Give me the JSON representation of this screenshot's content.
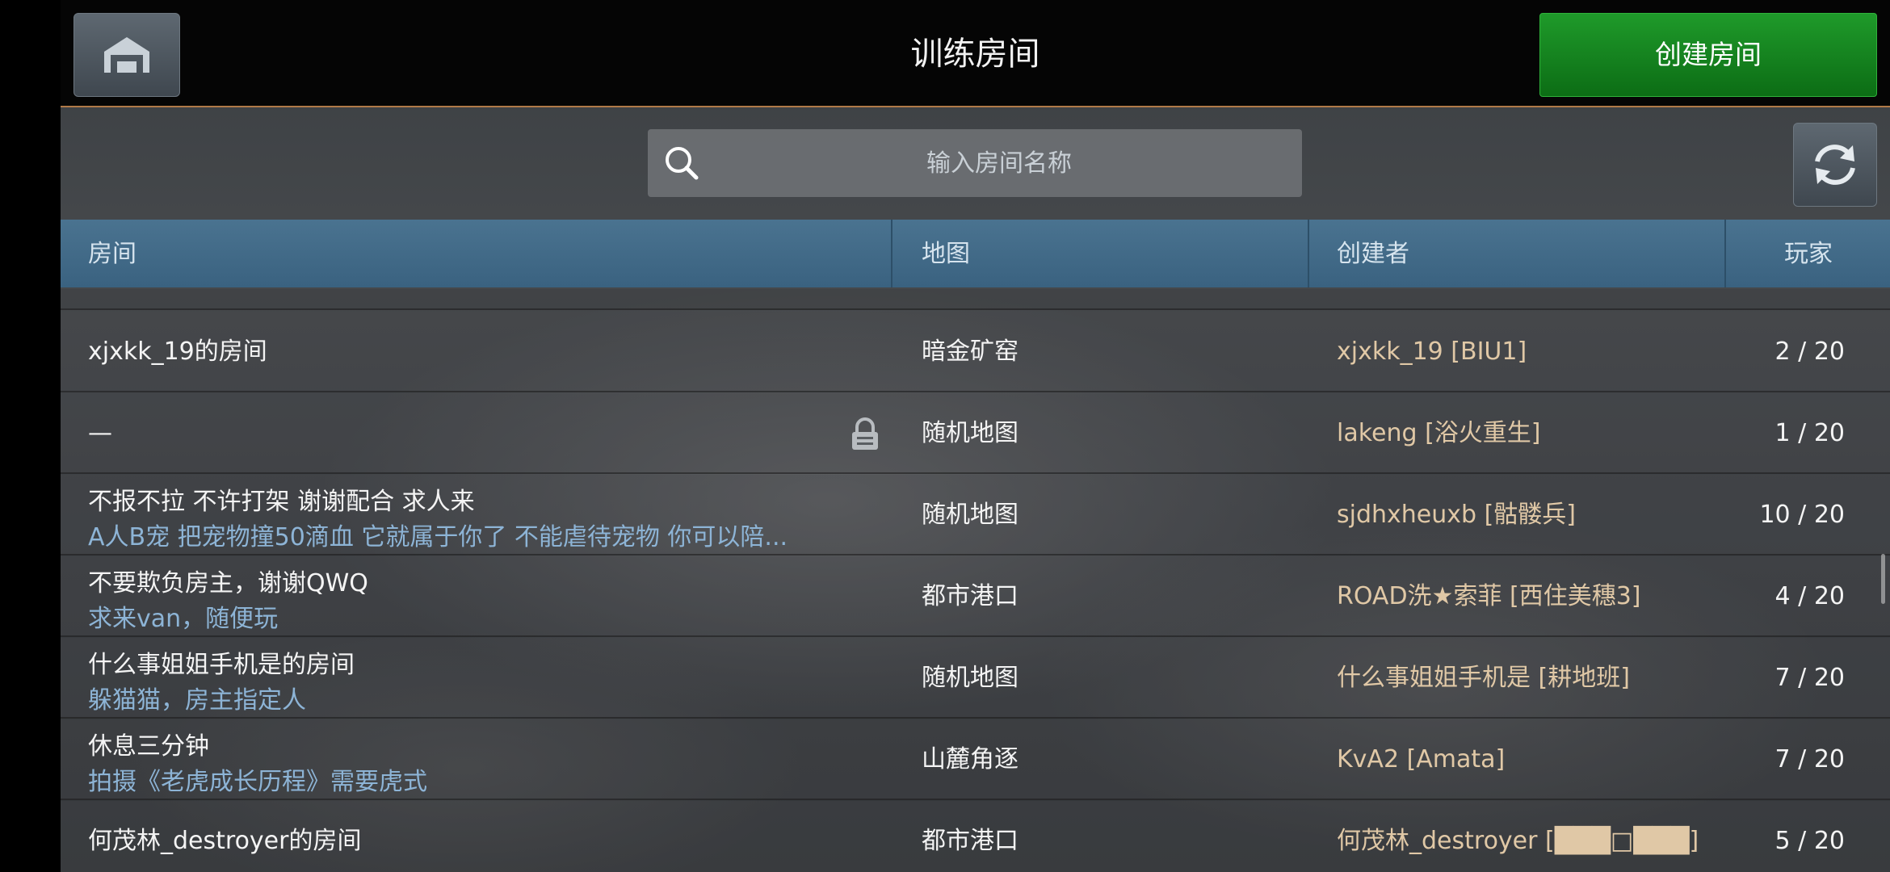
{
  "header": {
    "title": "训练房间",
    "create_label": "创建房间"
  },
  "search": {
    "placeholder": "输入房间名称"
  },
  "columns": {
    "room": "房间",
    "map": "地图",
    "creator": "创建者",
    "players": "玩家"
  },
  "rows": [
    {
      "room": "xjxkk_19的房间",
      "desc": "",
      "locked": false,
      "map": "暗金矿窑",
      "creator": "xjxkk_19 [BIU1]",
      "players": "2 / 20"
    },
    {
      "room": "—",
      "desc": "",
      "locked": true,
      "map": "随机地图",
      "creator": "lakeng [浴火重生]",
      "players": "1 / 20"
    },
    {
      "room": "不报不拉   不许打架    谢谢配合   求人来",
      "desc": "A人B宠  把宠物撞50滴血   它就属于你了   不能虐待宠物   你可以陪...",
      "locked": false,
      "map": "随机地图",
      "creator": "sjdhxheuxb [骷髅兵]",
      "players": "10 / 20"
    },
    {
      "room": "不要欺负房主，谢谢QWQ",
      "desc": "求来van，随便玩",
      "locked": false,
      "map": "都市港口",
      "creator": "ROAD洗★索菲 [西住美穗3]",
      "players": "4 / 20"
    },
    {
      "room": "什么事姐姐手机是的房间",
      "desc": "躲猫猫，房主指定人",
      "locked": false,
      "map": "随机地图",
      "creator": "什么事姐姐手机是 [耕地班]",
      "players": "7 / 20"
    },
    {
      "room": "休息三分钟",
      "desc": "拍摄《老虎成长历程》需要虎式",
      "locked": false,
      "map": "山麓角逐",
      "creator": "KvA2 [Amata]",
      "players": "7 / 20"
    },
    {
      "room": "何茂林_destroyer的房间",
      "desc": "",
      "locked": false,
      "map": "都市港口",
      "creator": "何茂林_destroyer [███□███]",
      "players": "5 / 20"
    }
  ],
  "icons": {
    "home": "home-icon",
    "search": "search-icon",
    "refresh": "refresh-icon",
    "lock": "lock-icon"
  },
  "colors": {
    "accent_green": "#1f9a2a",
    "header_blue": "#3a6280",
    "creator_text": "#e0c8a6",
    "desc_text": "#8db4d6",
    "divider_orange": "#b07a48"
  }
}
